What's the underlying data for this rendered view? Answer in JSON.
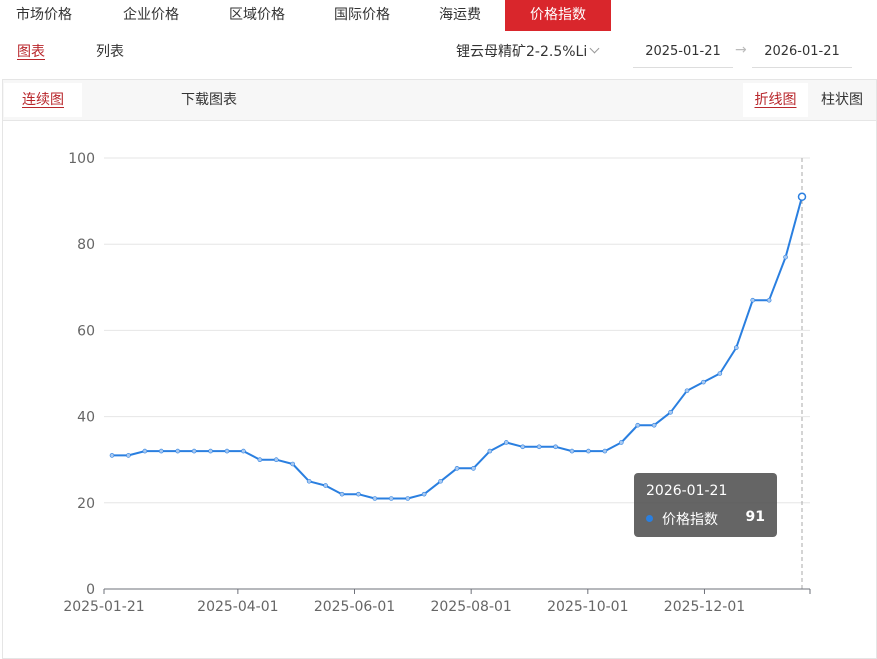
{
  "top_tabs": [
    {
      "label": "市场价格"
    },
    {
      "label": "企业价格"
    },
    {
      "label": "区域价格"
    },
    {
      "label": "国际价格"
    },
    {
      "label": "海运费"
    },
    {
      "label": "价格指数",
      "active": true
    }
  ],
  "view_tabs": {
    "chart": "图表",
    "list": "列表"
  },
  "product_select": {
    "value": "锂云母精矿2-2.5%Li"
  },
  "date_range": {
    "start": "2025-01-21",
    "end": "2026-01-21"
  },
  "toolbar": {
    "continuous": "连续图",
    "download": "下载图表",
    "line": "折线图",
    "bar": "柱状图"
  },
  "tooltip": {
    "date": "2026-01-21",
    "series": "价格指数",
    "value": "91"
  },
  "colors": {
    "accent": "#d9262c",
    "line": "#2a7fe0",
    "active_text": "#b8262b"
  },
  "chart_data": {
    "type": "line",
    "ylim": [
      0,
      100
    ],
    "yticks": [
      0,
      20,
      40,
      60,
      80,
      100
    ],
    "xtick_labels": [
      "2025-01-21",
      "2025-04-01",
      "2025-06-01",
      "2025-08-01",
      "2025-10-01",
      "2025-12-01"
    ],
    "x": [
      "2025-01-21",
      "2025-01-28",
      "2025-02-06",
      "2025-02-13",
      "2025-02-20",
      "2025-02-27",
      "2025-03-06",
      "2025-03-13",
      "2025-03-20",
      "2025-03-27",
      "2025-04-03",
      "2025-04-10",
      "2025-04-17",
      "2025-04-24",
      "2025-05-01",
      "2025-05-08",
      "2025-05-15",
      "2025-05-22",
      "2025-05-29",
      "2025-06-05",
      "2025-06-12",
      "2025-06-19",
      "2025-06-26",
      "2025-07-03",
      "2025-07-10",
      "2025-07-17",
      "2025-07-24",
      "2025-07-31",
      "2025-08-07",
      "2025-08-14",
      "2025-08-21",
      "2025-08-28",
      "2025-09-04",
      "2025-09-11",
      "2025-09-18",
      "2025-09-25",
      "2025-10-02",
      "2025-10-09",
      "2025-10-16",
      "2025-10-23",
      "2025-10-30",
      "2025-11-06",
      "2025-11-13",
      "2025-11-20",
      "2025-11-27",
      "2025-12-04",
      "2025-12-11",
      "2025-12-18",
      "2025-12-25",
      "2026-01-01",
      "2026-01-08",
      "2026-01-21"
    ],
    "series": [
      {
        "name": "价格指数",
        "values": [
          31,
          31,
          32,
          32,
          32,
          32,
          32,
          32,
          32,
          30,
          30,
          29,
          25,
          24,
          22,
          22,
          21,
          21,
          21,
          22,
          25,
          28,
          28,
          32,
          34,
          33,
          33,
          33,
          32,
          32,
          32,
          34,
          38,
          38,
          41,
          46,
          48,
          50,
          56,
          67,
          67,
          77,
          91
        ]
      }
    ]
  }
}
